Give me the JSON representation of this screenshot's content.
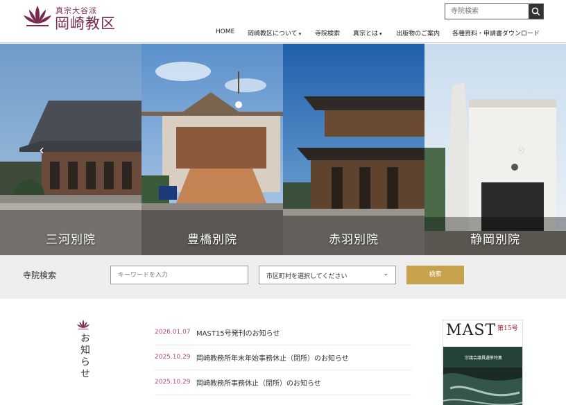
{
  "header": {
    "logo_sub": "真宗大谷派",
    "logo_main": "岡崎教区",
    "search_placeholder": "寺院検索",
    "nav": [
      {
        "label": "HOME",
        "caret": ""
      },
      {
        "label": "岡崎教区について",
        "caret": "▾"
      },
      {
        "label": "寺院検索",
        "caret": ""
      },
      {
        "label": "真宗とは",
        "caret": "▾"
      },
      {
        "label": "出版物のご案内",
        "caret": ""
      },
      {
        "label": "各種資料・申請書ダウンロード",
        "caret": ""
      }
    ]
  },
  "slider": {
    "panels": [
      {
        "label": "三河別院"
      },
      {
        "label": "豊橋別院"
      },
      {
        "label": "赤羽別院"
      },
      {
        "label": "静岡別院"
      }
    ],
    "prev_icon": "chevron-left-icon",
    "next_icon": "chevron-right-icon"
  },
  "temple_search": {
    "title": "寺院検索",
    "keyword_placeholder": "キーワードを入力",
    "select_value": "市区町村を選択してください",
    "button_label": "検索"
  },
  "news": {
    "heading": "お知らせ",
    "items": [
      {
        "date": "2026.01.07",
        "title": "MAST15号発刊のお知らせ"
      },
      {
        "date": "2025.10.29",
        "title": "岡崎教務所年末年始事務休止（閉所）のお知らせ"
      },
      {
        "date": "2025.10.29",
        "title": "岡崎教務所事務休止（閉所）のお知らせ"
      }
    ]
  },
  "magazine": {
    "title": "MAST",
    "issue": "第15号",
    "subtitle": "宗議会議員選挙特集"
  },
  "colors": {
    "brand": "#7a2a4f",
    "accent_gold": "#c7a24c",
    "date_pink": "#b24a78"
  }
}
